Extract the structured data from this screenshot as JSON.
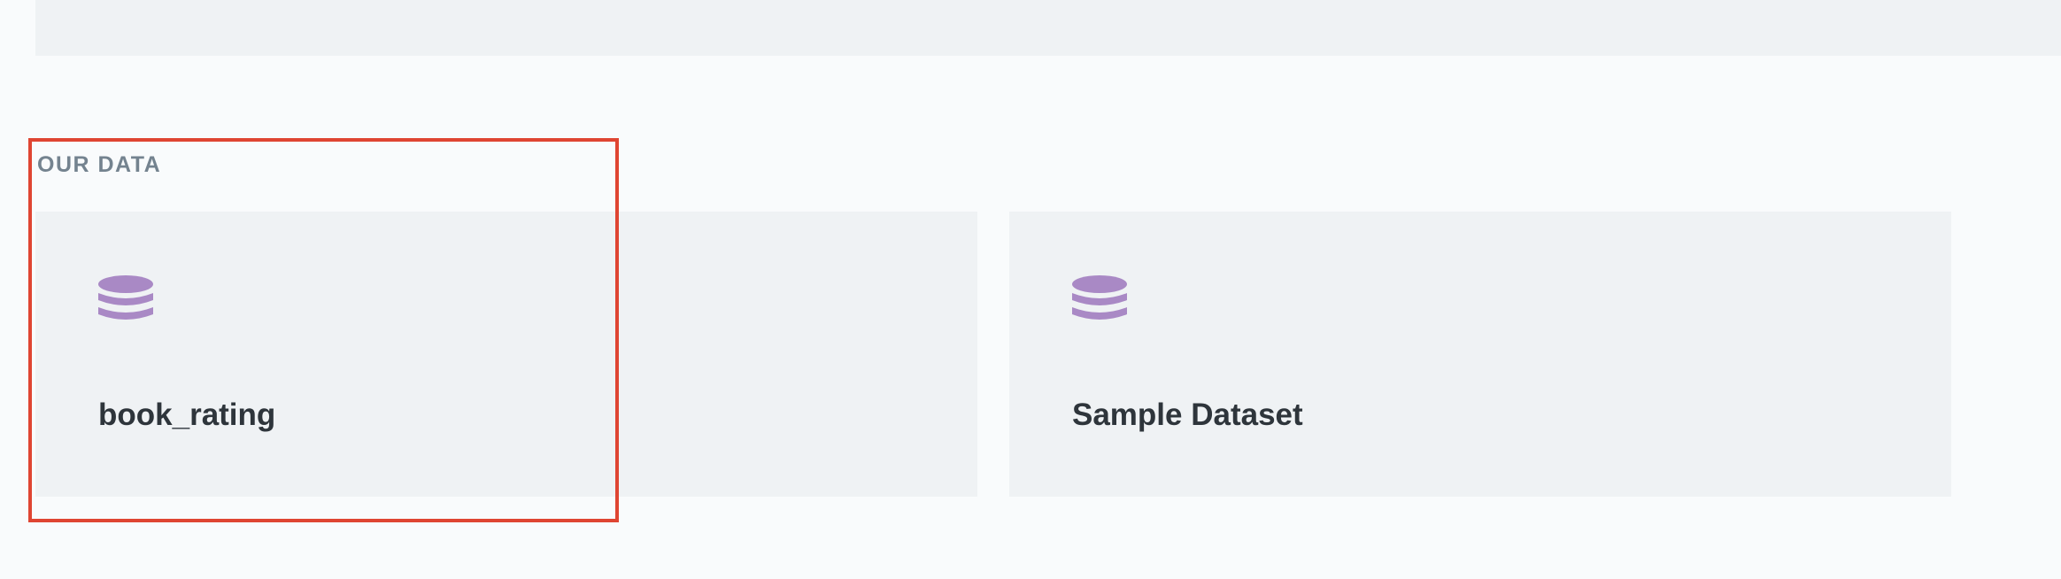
{
  "top_bar": {},
  "our_data": {
    "heading": "OUR DATA",
    "databases": [
      {
        "name": "book_rating",
        "icon": "database-icon",
        "icon_color": "#a989c5"
      },
      {
        "name": "Sample Dataset",
        "icon": "database-icon",
        "icon_color": "#a989c5"
      }
    ]
  },
  "highlight": {
    "color": "#df4532"
  }
}
